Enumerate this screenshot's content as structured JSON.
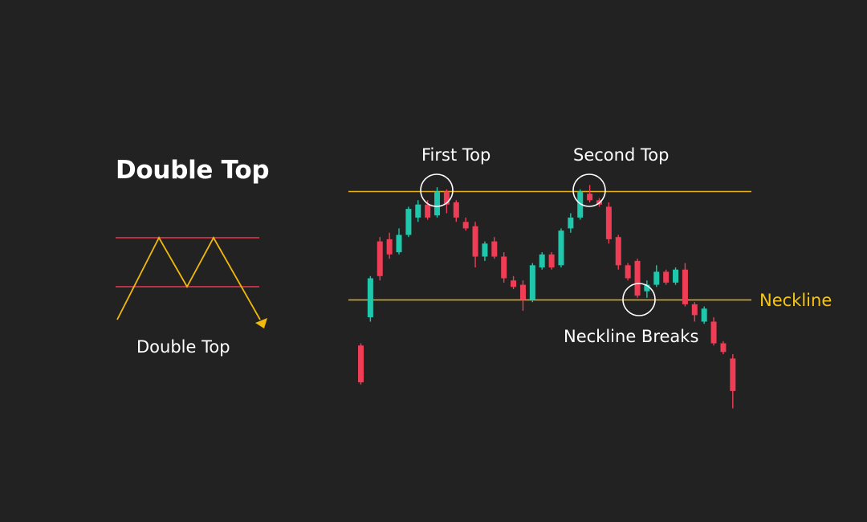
{
  "title": "Double Top",
  "pattern_label": "Double Top",
  "colors": {
    "background": "#222222",
    "bull": "#1fc7ad",
    "bear": "#ef3d56",
    "level_line": "#e8b012",
    "neckline_text": "#f5c518",
    "diagram_red": "#e8384f",
    "diagram_yellow": "#f0b90b",
    "text": "#ffffff"
  },
  "chart_data": {
    "type": "candlestick",
    "title": "",
    "xlabel": "",
    "ylabel": "",
    "annotations": [
      {
        "text": "First Top",
        "at_candle": 8
      },
      {
        "text": "Second Top",
        "at_candle": 24
      },
      {
        "text": "Neckline Breaks",
        "at_candle": 29
      }
    ],
    "levels": [
      {
        "name": "resistance",
        "label": "",
        "value": 100
      },
      {
        "name": "neckline",
        "label": "Neckline",
        "value": 50
      }
    ],
    "candles": [
      {
        "o": 29,
        "c": 12,
        "h": 30,
        "l": 11
      },
      {
        "o": 42,
        "c": 60,
        "h": 61,
        "l": 40
      },
      {
        "o": 77,
        "c": 61,
        "h": 79,
        "l": 59
      },
      {
        "o": 78,
        "c": 71,
        "h": 81,
        "l": 69
      },
      {
        "o": 72,
        "c": 80,
        "h": 83,
        "l": 71
      },
      {
        "o": 80,
        "c": 92,
        "h": 93,
        "l": 79
      },
      {
        "o": 88,
        "c": 94,
        "h": 96,
        "l": 86
      },
      {
        "o": 94,
        "c": 88,
        "h": 96,
        "l": 87
      },
      {
        "o": 89,
        "c": 100,
        "h": 102,
        "l": 88
      },
      {
        "o": 100,
        "c": 94,
        "h": 101,
        "l": 90
      },
      {
        "o": 95,
        "c": 88,
        "h": 96,
        "l": 86
      },
      {
        "o": 86,
        "c": 83,
        "h": 88,
        "l": 82
      },
      {
        "o": 84,
        "c": 70,
        "h": 86,
        "l": 65
      },
      {
        "o": 70,
        "c": 76,
        "h": 77,
        "l": 68
      },
      {
        "o": 77,
        "c": 70,
        "h": 79,
        "l": 69
      },
      {
        "o": 70,
        "c": 60,
        "h": 72,
        "l": 58
      },
      {
        "o": 59,
        "c": 56,
        "h": 61,
        "l": 55
      },
      {
        "o": 57,
        "c": 50,
        "h": 59,
        "l": 45
      },
      {
        "o": 50,
        "c": 66,
        "h": 67,
        "l": 49
      },
      {
        "o": 65,
        "c": 71,
        "h": 72,
        "l": 64
      },
      {
        "o": 71,
        "c": 65,
        "h": 72,
        "l": 64
      },
      {
        "o": 66,
        "c": 82,
        "h": 83,
        "l": 65
      },
      {
        "o": 83,
        "c": 88,
        "h": 90,
        "l": 81
      },
      {
        "o": 88,
        "c": 100,
        "h": 101,
        "l": 87
      },
      {
        "o": 99,
        "c": 96,
        "h": 103,
        "l": 95
      },
      {
        "o": 96,
        "c": 94,
        "h": 97,
        "l": 93
      },
      {
        "o": 93,
        "c": 78,
        "h": 95,
        "l": 76
      },
      {
        "o": 79,
        "c": 66,
        "h": 80,
        "l": 64
      },
      {
        "o": 66,
        "c": 60,
        "h": 67,
        "l": 59
      },
      {
        "o": 68,
        "c": 52,
        "h": 69,
        "l": 51
      },
      {
        "o": 54,
        "c": 57,
        "h": 59,
        "l": 51
      },
      {
        "o": 57,
        "c": 63,
        "h": 66,
        "l": 56
      },
      {
        "o": 63,
        "c": 58,
        "h": 64,
        "l": 57
      },
      {
        "o": 58,
        "c": 64,
        "h": 65,
        "l": 57
      },
      {
        "o": 64,
        "c": 48,
        "h": 67,
        "l": 47
      },
      {
        "o": 48,
        "c": 43,
        "h": 49,
        "l": 40
      },
      {
        "o": 40,
        "c": 46,
        "h": 47,
        "l": 39
      },
      {
        "o": 40,
        "c": 30,
        "h": 42,
        "l": 29
      },
      {
        "o": 30,
        "c": 26,
        "h": 31,
        "l": 25
      },
      {
        "o": 23,
        "c": 8,
        "h": 25,
        "l": 0
      }
    ]
  }
}
